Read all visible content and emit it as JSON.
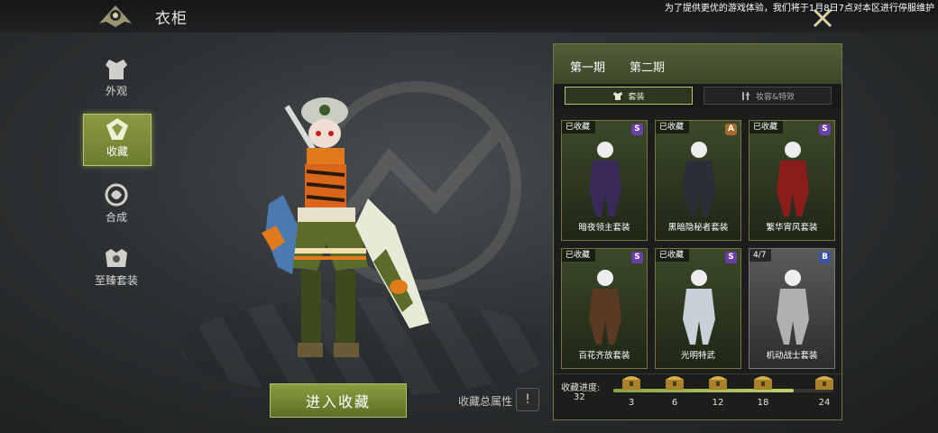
{
  "header": {
    "title": "衣柜",
    "notice": "为了提供更优的游戏体验，我们将于1月8日7点对本区进行停服维护"
  },
  "sidebar": {
    "items": [
      {
        "label": "外观",
        "icon": "armor-icon",
        "active": false
      },
      {
        "label": "收藏",
        "icon": "collection-icon",
        "active": true
      },
      {
        "label": "合成",
        "icon": "synthesis-icon",
        "active": false
      },
      {
        "label": "至臻套装",
        "icon": "ultimate-set-icon",
        "active": false
      }
    ]
  },
  "main": {
    "enter_button": "进入收藏",
    "total_attr_label": "收藏总属性",
    "info_icon": "!"
  },
  "panel": {
    "tabs": [
      {
        "label": "第一期",
        "active": true
      },
      {
        "label": "第二期",
        "active": false
      }
    ],
    "subtabs": [
      {
        "label": "套装",
        "icon": "costume-icon",
        "active": true
      },
      {
        "label": "妆容&特效",
        "icon": "makeup-icon",
        "active": false
      }
    ],
    "cards": [
      {
        "tag": "已收藏",
        "grade": "S",
        "grade_color": "#6b3fa8",
        "name": "暗夜领主套装",
        "style": "dark"
      },
      {
        "tag": "已收藏",
        "grade": "A",
        "grade_color": "#a86a2a",
        "name": "黑暗隐秘者套装",
        "style": "dark"
      },
      {
        "tag": "已收藏",
        "grade": "S",
        "grade_color": "#6b3fa8",
        "name": "繁华宵风套装",
        "style": "dark"
      },
      {
        "tag": "已收藏",
        "grade": "S",
        "grade_color": "#6b3fa8",
        "name": "百花齐放套装",
        "style": "dark"
      },
      {
        "tag": "已收藏",
        "grade": "S",
        "grade_color": "#6b3fa8",
        "name": "光明特武",
        "style": "dark"
      },
      {
        "tag": "4/7",
        "grade": "B",
        "grade_color": "#3b54a8",
        "name": "机动战士套装",
        "style": "grey"
      }
    ],
    "progress": {
      "label": "收藏进度:",
      "value": "32",
      "fraction": 0.82,
      "milestones": [
        "3",
        "6",
        "12",
        "18",
        "24"
      ]
    }
  },
  "colors": {
    "accent": "#8a9a43",
    "panel_border": "#6f7740",
    "s_grade": "#6b3fa8"
  }
}
